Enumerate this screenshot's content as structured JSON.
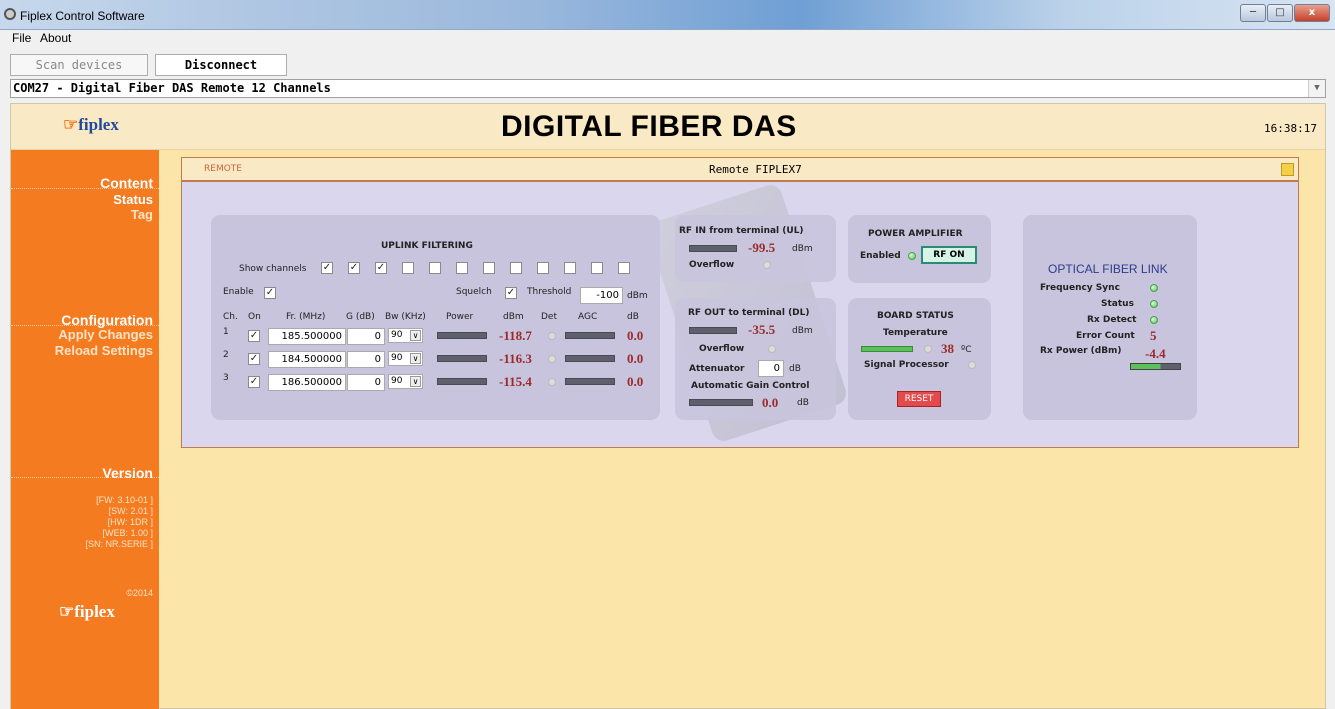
{
  "window": {
    "title": "Fiplex Control Software"
  },
  "menu": {
    "file": "File",
    "about": "About"
  },
  "toolbar": {
    "scan_label": "Scan devices",
    "disconnect_label": "Disconnect"
  },
  "device": {
    "selected": "COM27 - Digital Fiber DAS Remote 12 Channels"
  },
  "header": {
    "logo": "fiplex",
    "title": "DIGITAL FIBER DAS",
    "time": "16:38:17"
  },
  "sidebar": {
    "content_heading": "Content",
    "items": [
      {
        "label": "Status",
        "selected": true
      },
      {
        "label": "Tag",
        "selected": false
      }
    ],
    "config_heading": "Configuration",
    "config_items": [
      {
        "label": "Apply Changes"
      },
      {
        "label": "Reload Settings"
      }
    ],
    "version_heading": "Version",
    "version_lines": [
      "[FW: 3.10-01 ]",
      "[SW: 2.01 ]",
      "[HW:   1DR ]",
      "[WEB: 1.00 ]",
      "[SN: NR.SERIE ]"
    ],
    "copyright": "©2014",
    "footer_logo": "fiplex"
  },
  "panel": {
    "remote_label": "REMOTE",
    "device_name": "Remote FIPLEX7",
    "uplink": {
      "title": "UPLINK FILTERING",
      "show_channels_label": "Show channels",
      "show_channels": [
        true,
        true,
        true,
        false,
        false,
        false,
        false,
        false,
        false,
        false,
        false,
        false
      ],
      "enable_label": "Enable",
      "enable": true,
      "squelch_label": "Squelch",
      "squelch": true,
      "threshold_label": "Threshold",
      "threshold_value": "-100",
      "threshold_unit": "dBm",
      "columns": [
        "Ch.",
        "On",
        "Fr. (MHz)",
        "G (dB)",
        "Bw (KHz)",
        "Power",
        "dBm",
        "Det",
        "AGC",
        "dB"
      ],
      "channels": [
        {
          "ch": "1",
          "on": true,
          "freq": "185.500000",
          "gain": "0",
          "bw": "90",
          "dbm": "-118.7",
          "agc": "0.0"
        },
        {
          "ch": "2",
          "on": true,
          "freq": "184.500000",
          "gain": "0",
          "bw": "90",
          "dbm": "-116.3",
          "agc": "0.0"
        },
        {
          "ch": "3",
          "on": true,
          "freq": "186.500000",
          "gain": "0",
          "bw": "90",
          "dbm": "-115.4",
          "agc": "0.0"
        }
      ]
    },
    "rf_in": {
      "title": "RF IN from terminal (UL)",
      "value": "-99.5",
      "unit": "dBm",
      "overflow_label": "Overflow"
    },
    "rf_out": {
      "title": "RF OUT to terminal (DL)",
      "value": "-35.5",
      "unit": "dBm",
      "overflow_label": "Overflow",
      "attenuator_label": "Attenuator",
      "attenuator_value": "0",
      "attenuator_unit": "dB",
      "agc_label": "Automatic Gain Control",
      "agc_value": "0.0",
      "agc_unit": "dB"
    },
    "power_amp": {
      "title": "POWER AMPLIFIER",
      "enabled_label": "Enabled",
      "button_label": "RF ON"
    },
    "board": {
      "title": "BOARD STATUS",
      "temp_label": "Temperature",
      "temp_value": "38",
      "temp_unit": "ºC",
      "sp_label": "Signal Processor",
      "reset_label": "RESET"
    },
    "optical": {
      "title": "OPTICAL FIBER LINK",
      "freq_sync_label": "Frequency Sync",
      "status_label": "Status",
      "rx_detect_label": "Rx Detect",
      "error_count_label": "Error Count",
      "error_count": "5",
      "rx_power_label": "Rx Power (dBm)",
      "rx_power": "-4.4"
    }
  },
  "colors": {
    "accent": "#f47b20",
    "panel_bg": "#d9d6ee",
    "value_red": "#9b2a2a",
    "led_green": "#55c055"
  }
}
